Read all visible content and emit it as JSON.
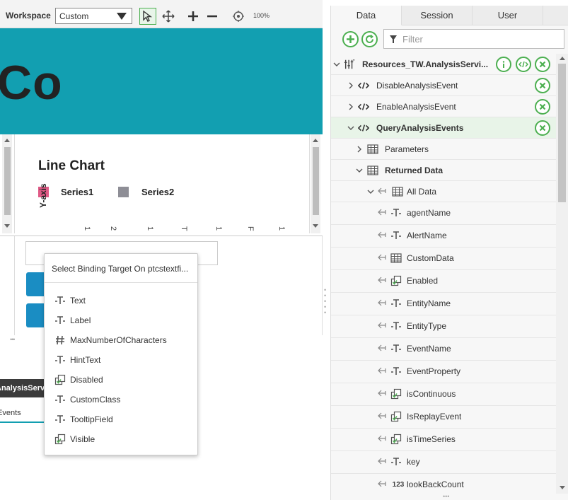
{
  "toolbar": {
    "workspace_label": "Workspace",
    "workspace_value": "Custom",
    "zoom_level": "100%"
  },
  "canvas": {
    "banner_text": "Co",
    "chart": {
      "title": "Line Chart",
      "legend": [
        "Series1",
        "Series2"
      ],
      "ylabel": "Y-axis",
      "ticks": [
        "1",
        "2",
        "1",
        "T",
        "1",
        "F",
        "1"
      ]
    }
  },
  "lower_left": {
    "service_tab": "AnalysisServices",
    "service_sub": "Events"
  },
  "popup": {
    "title": "Select Binding Target On ptcstextfi...",
    "items": [
      {
        "label": "Text",
        "icon": "text-type-icon"
      },
      {
        "label": "Label",
        "icon": "text-type-icon"
      },
      {
        "label": "MaxNumberOfCharacters",
        "icon": "number-type-icon"
      },
      {
        "label": "HintText",
        "icon": "text-type-icon"
      },
      {
        "label": "Disabled",
        "icon": "boolean-type-icon"
      },
      {
        "label": "CustomClass",
        "icon": "text-type-icon"
      },
      {
        "label": "TooltipField",
        "icon": "text-type-icon"
      },
      {
        "label": "Visible",
        "icon": "boolean-type-icon"
      }
    ]
  },
  "right_panel": {
    "tabs": [
      "Data",
      "Session",
      "User"
    ],
    "filter_placeholder": "Filter",
    "tree": {
      "root": "Resources_TW.AnalysisServi...",
      "services": [
        "DisableAnalysisEvent",
        "EnableAnalysisEvent",
        "QueryAnalysisEvents"
      ],
      "parameters": "Parameters",
      "returned_data": "Returned Data",
      "all_data": "All Data",
      "fields": [
        {
          "label": "agentName",
          "type": "text"
        },
        {
          "label": "AlertName",
          "type": "text"
        },
        {
          "label": "CustomData",
          "type": "table"
        },
        {
          "label": "Enabled",
          "type": "boolean"
        },
        {
          "label": "EntityName",
          "type": "text"
        },
        {
          "label": "EntityType",
          "type": "text"
        },
        {
          "label": "EventName",
          "type": "text"
        },
        {
          "label": "EventProperty",
          "type": "text"
        },
        {
          "label": "isContinuous",
          "type": "boolean"
        },
        {
          "label": "IsReplayEvent",
          "type": "boolean"
        },
        {
          "label": "isTimeSeries",
          "type": "boolean"
        },
        {
          "label": "key",
          "type": "text"
        },
        {
          "label": "lookBackCount",
          "type": "number"
        }
      ],
      "number_prefix": "123"
    },
    "colors": {
      "accent_green": "#4caf50",
      "banner": "#129fb1",
      "series1": "#e05a86",
      "series2": "#8e8e96"
    }
  }
}
